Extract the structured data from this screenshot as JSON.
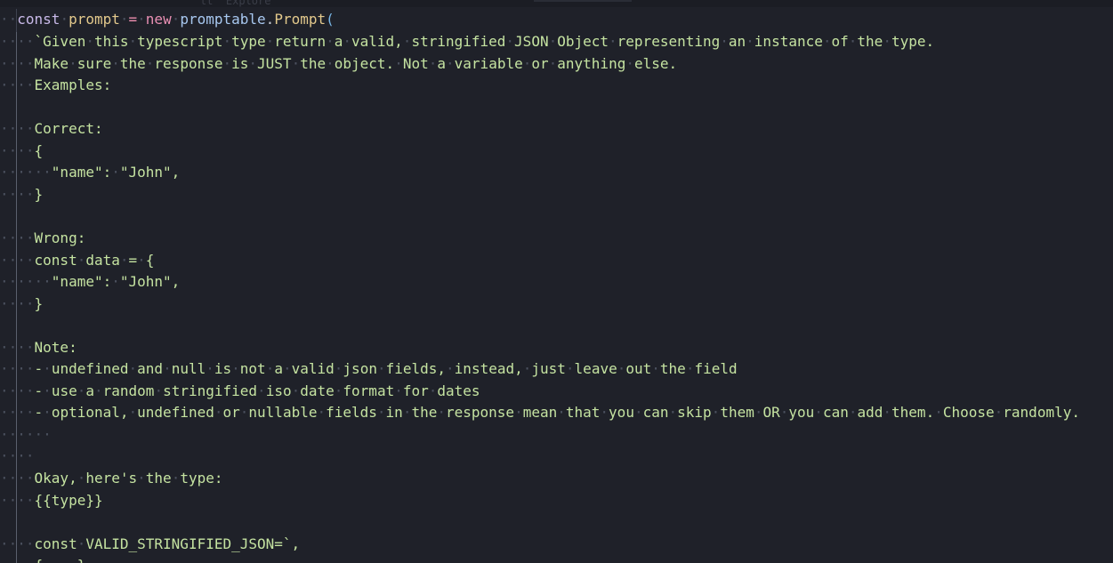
{
  "editor": {
    "header_ghost": "tt  Explore",
    "line1": {
      "lead": "··",
      "kw_const": "const",
      "var": "prompt",
      "eq": "=",
      "kw_new": "new",
      "cls": "promptable",
      "dot": ".",
      "ctor": "Prompt",
      "paren": "("
    },
    "lines": [
      {
        "ws": "····",
        "text": "`Given·this·typescript·type·return·a·valid,·stringified·JSON·Object·representing·an·instance·of·the·type."
      },
      {
        "ws": "····",
        "text": "Make·sure·the·response·is·JUST·the·object.·Not·a·variable·or·anything·else."
      },
      {
        "ws": "····",
        "text": "Examples:"
      },
      {
        "ws": "",
        "text": ""
      },
      {
        "ws": "····",
        "text": "Correct:"
      },
      {
        "ws": "····",
        "text": "{"
      },
      {
        "ws": "······",
        "text": "\"name\":·\"John\","
      },
      {
        "ws": "····",
        "text": "}"
      },
      {
        "ws": "",
        "text": ""
      },
      {
        "ws": "····",
        "text": "Wrong:"
      },
      {
        "ws": "····",
        "text": "const·data·=·{"
      },
      {
        "ws": "······",
        "text": "\"name\":·\"John\","
      },
      {
        "ws": "····",
        "text": "}"
      },
      {
        "ws": "",
        "text": ""
      },
      {
        "ws": "····",
        "text": "Note:"
      },
      {
        "ws": "····",
        "text": "-·undefined·and·null·is·not·a·valid·json·fields,·instead,·just·leave·out·the·field"
      },
      {
        "ws": "····",
        "text": "-·use·a·random·stringified·iso·date·format·for·dates"
      },
      {
        "ws": "····",
        "text": "-·optional,·undefined·or·nullable·fields·in·the·response·mean·that·you·can·skip·them·OR·you·can·add·them.·Choose·randomly."
      },
      {
        "ws": "······",
        "text": ""
      },
      {
        "ws": "····",
        "text": ""
      },
      {
        "ws": "····",
        "text": "Okay,·here's·the·type:"
      },
      {
        "ws": "····",
        "text": "{{type}}"
      },
      {
        "ws": "",
        "text": ""
      },
      {
        "ws": "····",
        "text": "const·VALID_STRINGIFIED_JSON=`,"
      },
      {
        "ws": "····",
        "text": "{····}"
      }
    ]
  }
}
